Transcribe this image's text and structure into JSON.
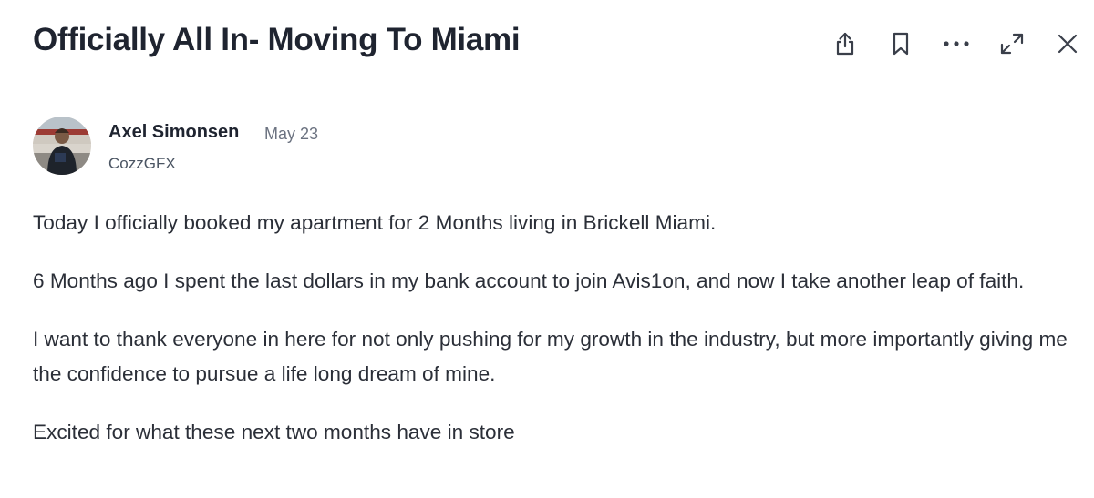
{
  "post": {
    "title": "Officially All In- Moving To Miami",
    "author": {
      "name": "Axel Simonsen",
      "date": "May 23",
      "handle": "CozzGFX"
    },
    "paragraphs": [
      "Today I officially booked my apartment for 2 Months living in Brickell Miami.",
      "6 Months ago I spent the last dollars in my bank account to join Avis1on, and now I take another leap of faith.",
      "I want to thank everyone in here for not only pushing for my growth in the industry, but more importantly giving me the confidence to pursue a life long dream of mine.",
      "Excited for what these next two months have in store"
    ]
  },
  "toolbar": {
    "icons": [
      "share-icon",
      "bookmark-icon",
      "more-icon",
      "expand-icon",
      "close-icon"
    ]
  },
  "colors": {
    "text": "#1f2430",
    "muted": "#6b7280",
    "icon": "#3a3f4a"
  }
}
